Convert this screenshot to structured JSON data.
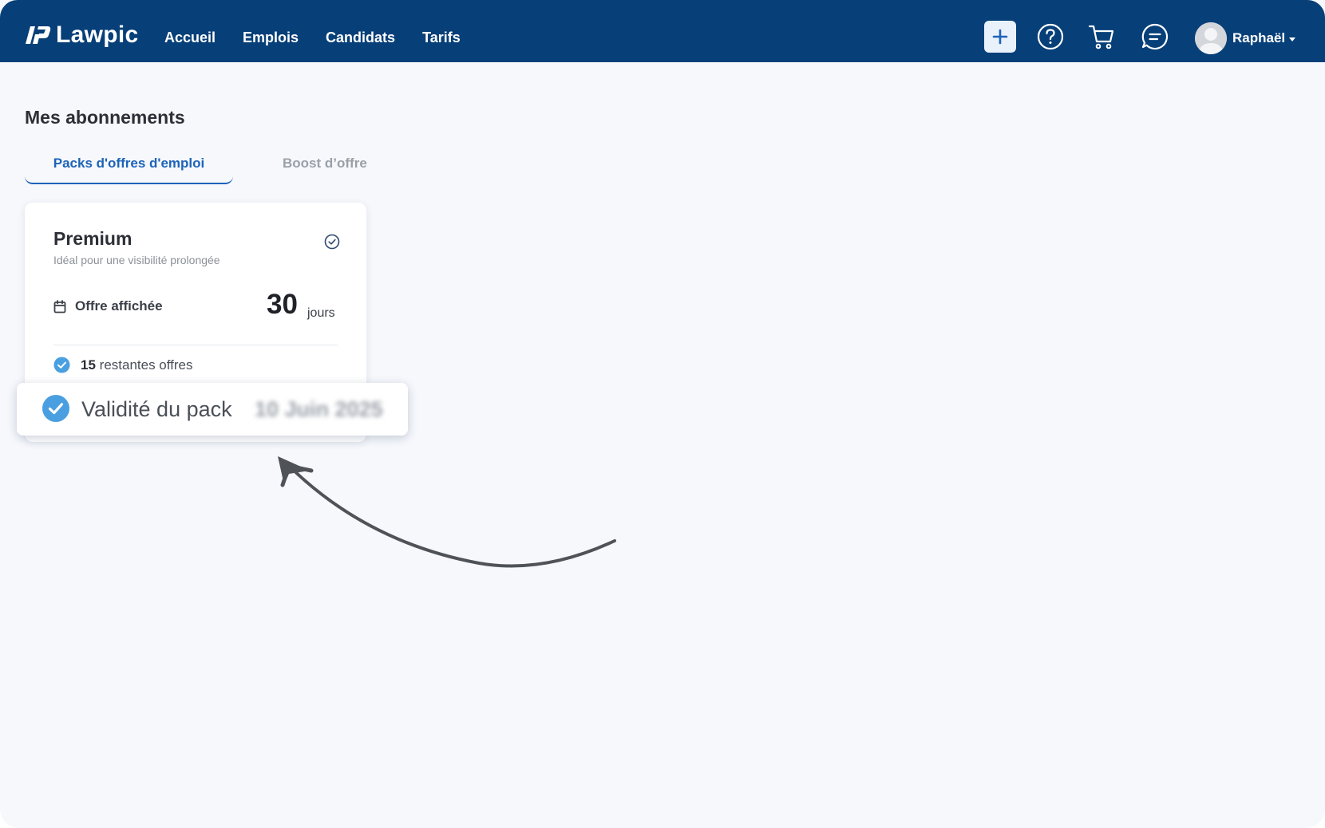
{
  "brand": {
    "name": "Lawpic"
  },
  "nav": {
    "items": [
      {
        "label": "Accueil"
      },
      {
        "label": "Emplois"
      },
      {
        "label": "Candidats"
      },
      {
        "label": "Tarifs"
      }
    ]
  },
  "topbar": {
    "plus_icon": "plus-icon",
    "help_icon": "help-icon",
    "cart_icon": "cart-icon",
    "chat_icon": "chat-icon",
    "user_name": "Raphaël"
  },
  "page": {
    "title": "Mes abonnements",
    "tabs": [
      {
        "label": "Packs d'offres d'emploi",
        "active": true
      },
      {
        "label": "Boost d’offre",
        "active": false
      }
    ]
  },
  "card": {
    "title": "Premium",
    "subtitle": "Idéal pour une visibilité prolongée",
    "offer_label": "Offre affichée",
    "days": "30",
    "days_unit": "jours",
    "remaining_count": "15",
    "remaining_label": "restantes offres",
    "validity_label": "Validité du pack",
    "validity_date": "10 Juin 2025"
  },
  "colors": {
    "topbar": "#073f78",
    "accent": "#1d63b8",
    "check": "#4a9fe0",
    "background": "#f6f8fc"
  }
}
